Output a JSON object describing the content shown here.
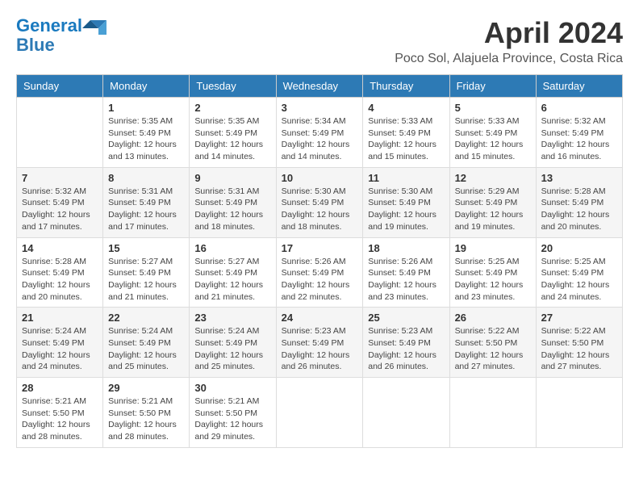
{
  "header": {
    "logo_line1": "General",
    "logo_line2": "Blue",
    "month_title": "April 2024",
    "location": "Poco Sol, Alajuela Province, Costa Rica"
  },
  "weekdays": [
    "Sunday",
    "Monday",
    "Tuesday",
    "Wednesday",
    "Thursday",
    "Friday",
    "Saturday"
  ],
  "weeks": [
    [
      {
        "day": "",
        "info": ""
      },
      {
        "day": "1",
        "info": "Sunrise: 5:35 AM\nSunset: 5:49 PM\nDaylight: 12 hours\nand 13 minutes."
      },
      {
        "day": "2",
        "info": "Sunrise: 5:35 AM\nSunset: 5:49 PM\nDaylight: 12 hours\nand 14 minutes."
      },
      {
        "day": "3",
        "info": "Sunrise: 5:34 AM\nSunset: 5:49 PM\nDaylight: 12 hours\nand 14 minutes."
      },
      {
        "day": "4",
        "info": "Sunrise: 5:33 AM\nSunset: 5:49 PM\nDaylight: 12 hours\nand 15 minutes."
      },
      {
        "day": "5",
        "info": "Sunrise: 5:33 AM\nSunset: 5:49 PM\nDaylight: 12 hours\nand 15 minutes."
      },
      {
        "day": "6",
        "info": "Sunrise: 5:32 AM\nSunset: 5:49 PM\nDaylight: 12 hours\nand 16 minutes."
      }
    ],
    [
      {
        "day": "7",
        "info": "Sunrise: 5:32 AM\nSunset: 5:49 PM\nDaylight: 12 hours\nand 17 minutes."
      },
      {
        "day": "8",
        "info": "Sunrise: 5:31 AM\nSunset: 5:49 PM\nDaylight: 12 hours\nand 17 minutes."
      },
      {
        "day": "9",
        "info": "Sunrise: 5:31 AM\nSunset: 5:49 PM\nDaylight: 12 hours\nand 18 minutes."
      },
      {
        "day": "10",
        "info": "Sunrise: 5:30 AM\nSunset: 5:49 PM\nDaylight: 12 hours\nand 18 minutes."
      },
      {
        "day": "11",
        "info": "Sunrise: 5:30 AM\nSunset: 5:49 PM\nDaylight: 12 hours\nand 19 minutes."
      },
      {
        "day": "12",
        "info": "Sunrise: 5:29 AM\nSunset: 5:49 PM\nDaylight: 12 hours\nand 19 minutes."
      },
      {
        "day": "13",
        "info": "Sunrise: 5:28 AM\nSunset: 5:49 PM\nDaylight: 12 hours\nand 20 minutes."
      }
    ],
    [
      {
        "day": "14",
        "info": "Sunrise: 5:28 AM\nSunset: 5:49 PM\nDaylight: 12 hours\nand 20 minutes."
      },
      {
        "day": "15",
        "info": "Sunrise: 5:27 AM\nSunset: 5:49 PM\nDaylight: 12 hours\nand 21 minutes."
      },
      {
        "day": "16",
        "info": "Sunrise: 5:27 AM\nSunset: 5:49 PM\nDaylight: 12 hours\nand 21 minutes."
      },
      {
        "day": "17",
        "info": "Sunrise: 5:26 AM\nSunset: 5:49 PM\nDaylight: 12 hours\nand 22 minutes."
      },
      {
        "day": "18",
        "info": "Sunrise: 5:26 AM\nSunset: 5:49 PM\nDaylight: 12 hours\nand 23 minutes."
      },
      {
        "day": "19",
        "info": "Sunrise: 5:25 AM\nSunset: 5:49 PM\nDaylight: 12 hours\nand 23 minutes."
      },
      {
        "day": "20",
        "info": "Sunrise: 5:25 AM\nSunset: 5:49 PM\nDaylight: 12 hours\nand 24 minutes."
      }
    ],
    [
      {
        "day": "21",
        "info": "Sunrise: 5:24 AM\nSunset: 5:49 PM\nDaylight: 12 hours\nand 24 minutes."
      },
      {
        "day": "22",
        "info": "Sunrise: 5:24 AM\nSunset: 5:49 PM\nDaylight: 12 hours\nand 25 minutes."
      },
      {
        "day": "23",
        "info": "Sunrise: 5:24 AM\nSunset: 5:49 PM\nDaylight: 12 hours\nand 25 minutes."
      },
      {
        "day": "24",
        "info": "Sunrise: 5:23 AM\nSunset: 5:49 PM\nDaylight: 12 hours\nand 26 minutes."
      },
      {
        "day": "25",
        "info": "Sunrise: 5:23 AM\nSunset: 5:49 PM\nDaylight: 12 hours\nand 26 minutes."
      },
      {
        "day": "26",
        "info": "Sunrise: 5:22 AM\nSunset: 5:50 PM\nDaylight: 12 hours\nand 27 minutes."
      },
      {
        "day": "27",
        "info": "Sunrise: 5:22 AM\nSunset: 5:50 PM\nDaylight: 12 hours\nand 27 minutes."
      }
    ],
    [
      {
        "day": "28",
        "info": "Sunrise: 5:21 AM\nSunset: 5:50 PM\nDaylight: 12 hours\nand 28 minutes."
      },
      {
        "day": "29",
        "info": "Sunrise: 5:21 AM\nSunset: 5:50 PM\nDaylight: 12 hours\nand 28 minutes."
      },
      {
        "day": "30",
        "info": "Sunrise: 5:21 AM\nSunset: 5:50 PM\nDaylight: 12 hours\nand 29 minutes."
      },
      {
        "day": "",
        "info": ""
      },
      {
        "day": "",
        "info": ""
      },
      {
        "day": "",
        "info": ""
      },
      {
        "day": "",
        "info": ""
      }
    ]
  ]
}
